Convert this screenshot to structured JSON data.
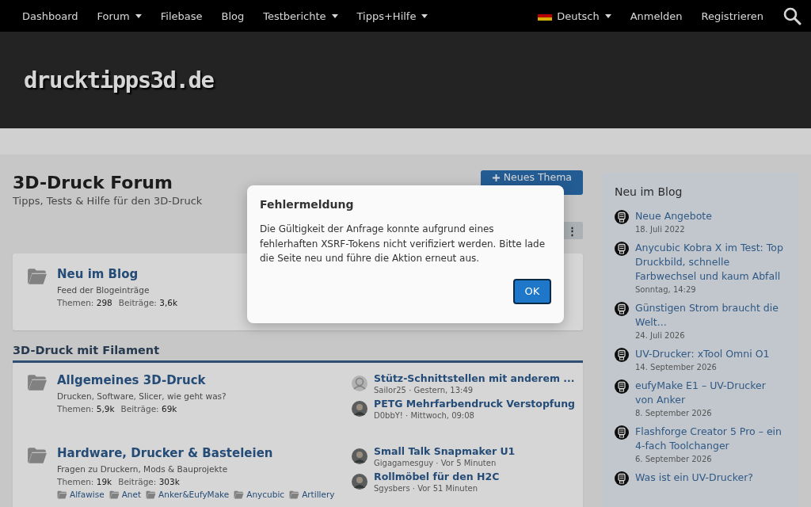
{
  "nav": {
    "items": [
      {
        "label": "Dashboard",
        "dropdown": false
      },
      {
        "label": "Forum",
        "dropdown": true
      },
      {
        "label": "Filebase",
        "dropdown": false
      },
      {
        "label": "Blog",
        "dropdown": false
      },
      {
        "label": "Testberichte",
        "dropdown": true
      },
      {
        "label": "Tipps+Hilfe",
        "dropdown": true
      }
    ],
    "language": {
      "label": "Deutsch",
      "dropdown": true
    },
    "links": [
      "Anmelden",
      "Registrieren"
    ]
  },
  "header": {
    "logo": "drucktipps3d.de"
  },
  "page": {
    "title": "3D-Druck Forum",
    "subtitle": "Tipps, Tests & Hilfe für den 3D-Druck",
    "new_topic_button": "Neues Thema",
    "more_button": "⋮"
  },
  "featured": {
    "name": "Neu im Blog",
    "description": "Feed der Blogeinträge",
    "stats": [
      {
        "label": "Themen:",
        "value": "298"
      },
      {
        "label": "Beiträge:",
        "value": "3,6k"
      }
    ]
  },
  "section": {
    "title": "3D-Druck mit Filament",
    "forums": [
      {
        "name": "Allgemeines 3D-Druck",
        "description": "Drucken, Software, Slicer, wie geht was?",
        "stats": [
          {
            "label": "Themen:",
            "value": "5,9k"
          },
          {
            "label": "Beiträge:",
            "value": "69k"
          }
        ],
        "last_posts": [
          {
            "title": "Stütz-Schnittstellen mit anderem ...",
            "meta": "Sailor25 · Gestern, 13:49",
            "kind": "default"
          },
          {
            "title": "PETG Mehrfarbendruck Verstopfung",
            "meta": "D0bbY! · Mittwoch, 09:08",
            "kind": "photo"
          }
        ]
      },
      {
        "name": "Hardware, Drucker & Basteleien",
        "description": "Fragen zu Druckern, Mods & Bauprojekte",
        "stats": [
          {
            "label": "Themen:",
            "value": "19k"
          },
          {
            "label": "Beiträge:",
            "value": "303k"
          }
        ],
        "last_posts": [
          {
            "title": "Small Talk Snapmaker U1",
            "meta": "Gigagamesguy · Vor 5 Minuten",
            "kind": "photo"
          },
          {
            "title": "Rollmöbel für den H2C",
            "meta": "Sgysbers · Vor 51 Minuten",
            "kind": "photo"
          }
        ],
        "subforums": [
          "Alfawise",
          "Anet",
          "Anker&EufyMake",
          "Anycubic",
          "Artillery"
        ]
      }
    ]
  },
  "sidebar": {
    "title": "Neu im Blog",
    "items": [
      {
        "title": "Neue Angebote",
        "date": "18. Juli 2022"
      },
      {
        "title": "Anycubic Kobra X im Test: Top Druckbild, schnelle Farbwechsel und kaum Abfall",
        "date": "Sonntag, 14:29"
      },
      {
        "title": "Günstigen Strom braucht die Welt...",
        "date": "24. Juli 2026"
      },
      {
        "title": "UV-Drucker: xTool Omni O1",
        "date": "14. September 2026"
      },
      {
        "title": "eufyMake E1 – UV-Drucker von Anker",
        "date": "8. September 2026"
      },
      {
        "title": "Flashforge Creator 5 Pro – ein 4-fach Toolchanger",
        "date": "6. September 2026"
      },
      {
        "title": "Was ist ein UV-Drucker?"
      }
    ]
  },
  "dialog": {
    "title": "Fehlermeldung",
    "message": "Die Gültigkeit der Anfrage konnte aufgrund eines fehlerhaften XSRF-Tokens nicht verifiziert werden. Bitte lade die Seite neu und führe die Aktion erneut aus.",
    "button": "OK"
  }
}
